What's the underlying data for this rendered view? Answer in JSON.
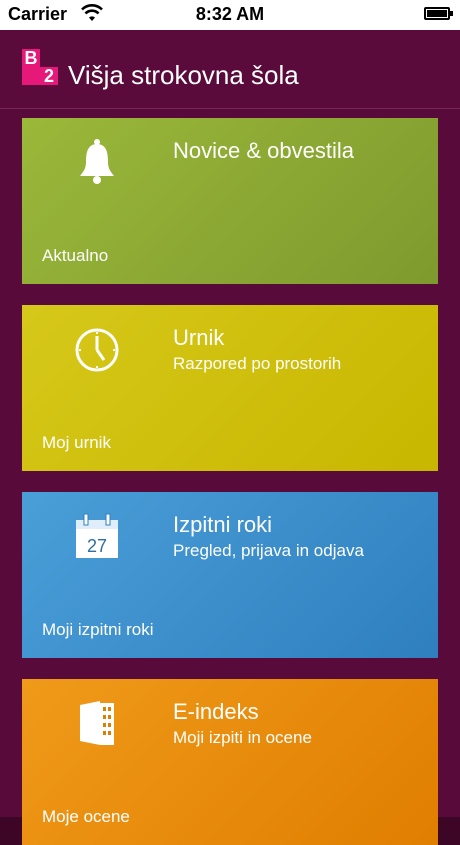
{
  "status": {
    "carrier": "Carrier",
    "time": "8:32 AM",
    "battery_level": 1.0
  },
  "header": {
    "logo_top": "B",
    "logo_bottom": "2",
    "title": "Višja strokovna šola"
  },
  "tiles": [
    {
      "title": "Novice & obvestila",
      "subtitle": "",
      "footer": "Aktualno",
      "icon": "bell-icon",
      "color_from": "#9bb83a",
      "color_to": "#7e9a2e"
    },
    {
      "title": "Urnik",
      "subtitle": "Razpored po prostorih",
      "footer": "Moj urnik",
      "icon": "clock-icon",
      "color_from": "#d6c81a",
      "color_to": "#c8b700"
    },
    {
      "title": "Izpitni roki",
      "subtitle": "Pregled, prijava in odjava",
      "footer": "Moji izpitni roki",
      "icon": "calendar-icon",
      "calendar_day": "27",
      "color_from": "#4a9fd8",
      "color_to": "#2f7fbf"
    },
    {
      "title": "E-indeks",
      "subtitle": "Moji izpiti in ocene",
      "footer": "Moje ocene",
      "icon": "document-icon",
      "color_from": "#f09a1a",
      "color_to": "#e07e00"
    }
  ]
}
